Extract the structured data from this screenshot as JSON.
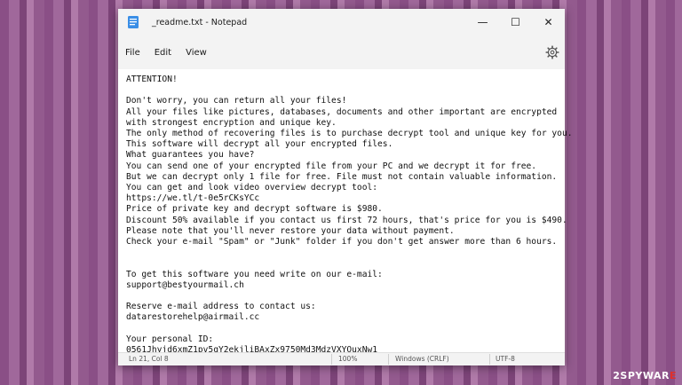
{
  "window": {
    "title": "_readme.txt - Notepad",
    "controls": {
      "minimize": "—",
      "maximize": "☐",
      "close": "✕"
    }
  },
  "menu": {
    "file": "File",
    "edit": "Edit",
    "view": "View"
  },
  "document": {
    "text": "ATTENTION!\n\nDon't worry, you can return all your files!\nAll your files like pictures, databases, documents and other important are encrypted\nwith strongest encryption and unique key.\nThe only method of recovering files is to purchase decrypt tool and unique key for you.\nThis software will decrypt all your encrypted files.\nWhat guarantees you have?\nYou can send one of your encrypted file from your PC and we decrypt it for free.\nBut we can decrypt only 1 file for free. File must not contain valuable information.\nYou can get and look video overview decrypt tool:\nhttps://we.tl/t-0e5rCKsYCc\nPrice of private key and decrypt software is $980.\nDiscount 50% available if you contact us first 72 hours, that's price for you is $490.\nPlease note that you'll never restore your data without payment.\nCheck your e-mail \"Spam\" or \"Junk\" folder if you don't get answer more than 6 hours.\n\n\nTo get this software you need write on our e-mail:\nsupport@bestyourmail.ch\n\nReserve e-mail address to contact us:\ndatarestorehelp@airmail.cc\n\nYour personal ID:\n0561Jhyjd6xmZ1pv5qY2ekjliBAxZx9750Md3MdzVXYOuxNw1"
  },
  "status": {
    "position": "Ln 21, Col 8",
    "zoom": "100%",
    "line_ending": "Windows (CRLF)",
    "encoding": "UTF-8"
  },
  "watermark": {
    "prefix": "2SPYWAR",
    "suffix": "E"
  }
}
